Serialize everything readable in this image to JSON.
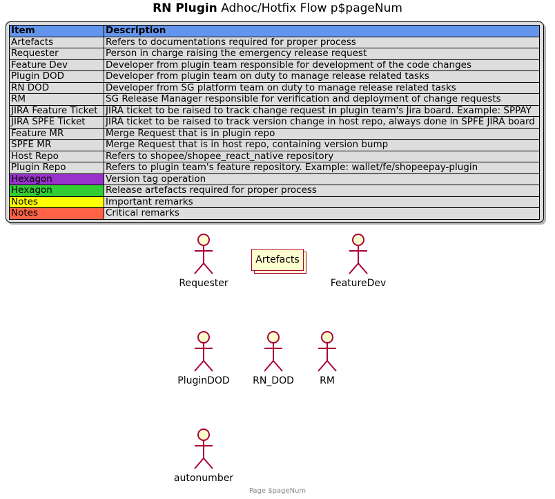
{
  "title": {
    "bold": "RN Plugin",
    "rest": "Adhoc/Hotfix Flow p$pageNum"
  },
  "legend": {
    "headers": {
      "item": "Item",
      "description": "Description"
    },
    "header_color": "#6495ED",
    "rows": [
      {
        "item": "Artefacts",
        "description": "Refers to documentations required for proper process",
        "color": ""
      },
      {
        "item": "Requester",
        "description": "Person in charge raising the emergency release request",
        "color": ""
      },
      {
        "item": "Feature Dev",
        "description": "Developer from plugin team responsible for development of the code changes",
        "color": ""
      },
      {
        "item": "Plugin DOD",
        "description": "Developer from plugin team on duty to manage release related tasks",
        "color": ""
      },
      {
        "item": "RN DOD",
        "description": "Developer from SG platform team on duty to manage release related tasks",
        "color": ""
      },
      {
        "item": "RM",
        "description": "SG Release Manager responsible for verification and deployment of change requests",
        "color": ""
      },
      {
        "item": "JIRA Feature Ticket",
        "description": "JIRA ticket to be raised to track change request in plugin team's Jira board. Example: SPPAY",
        "color": ""
      },
      {
        "item": "JIRA SPFE Ticket",
        "description": "JIRA ticket to be raised to track version change in host repo, always done in SPFE JIRA board",
        "color": ""
      },
      {
        "item": "Feature MR",
        "description": "Merge Request that is in plugin repo",
        "color": ""
      },
      {
        "item": "SPFE MR",
        "description": "Merge Request that is in host repo, containing version bump",
        "color": ""
      },
      {
        "item": "Host Repo",
        "description": "Refers to shopee/shopee_react_native repository",
        "color": ""
      },
      {
        "item": "Plugin Repo",
        "description": "Refers to plugin team's feature repository. Example: wallet/fe/shopeepay-plugin",
        "color": ""
      },
      {
        "item": "Hexagon",
        "description": "Version tag operation",
        "color": "#9932CC"
      },
      {
        "item": "Hexagon",
        "description": "Release artefacts required for proper process",
        "color": "#32CD32"
      },
      {
        "item": "Notes",
        "description": "Important remarks",
        "color": "#FFFF00"
      },
      {
        "item": "Notes",
        "description": "Critical remarks",
        "color": "#FF6347"
      }
    ]
  },
  "artefacts_label": "Artefacts",
  "actors": {
    "requester": "Requester",
    "featuredev": "FeatureDev",
    "plugindod": "PluginDOD",
    "rn_dod": "RN_DOD",
    "rm": "RM",
    "autonumber": "autonumber"
  },
  "actor_color": "#A80036",
  "actor_fill": "#FEFECE",
  "footer": "Page $pageNum"
}
